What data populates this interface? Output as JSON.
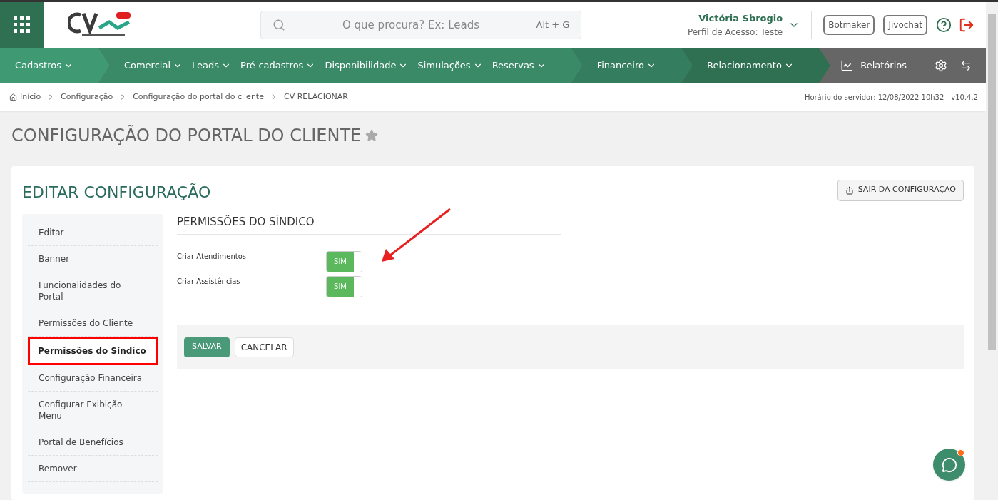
{
  "header": {
    "search": {
      "placeholder": "O que procura? Ex: Leads",
      "shortcut": "Alt + G"
    },
    "user": {
      "name": "Victória Sbrogio",
      "profile": "Perfil de Acesso: Teste"
    },
    "buttons": [
      "Botmaker",
      "Jivochat"
    ]
  },
  "nav": {
    "segments": [
      {
        "color": "#3f9a74",
        "items": [
          "Cadastros"
        ]
      },
      {
        "color": "#3a8a68",
        "items": [
          "Comercial",
          "Leads",
          "Pré-cadastros",
          "Disponibilidade",
          "Simulações",
          "Reservas"
        ]
      },
      {
        "color": "#357d5f",
        "items": [
          "Financeiro"
        ]
      },
      {
        "color": "#2f7053",
        "items": [
          "Relacionamento"
        ]
      }
    ],
    "reports": "Relatórios"
  },
  "breadcrumb": [
    "Início",
    "Configuração",
    "Configuração do portal do cliente",
    "CV RELACIONAR"
  ],
  "server_time": "Horário do servidor: 12/08/2022 10h32 - v10.4.2",
  "page_title": "CONFIGURAÇÃO DO PORTAL DO CLIENTE",
  "card": {
    "title": "EDITAR CONFIGURAÇÃO",
    "exit_button": "SAIR DA CONFIGURAÇÃO",
    "sidebar": [
      {
        "label": "Editar",
        "selected": false
      },
      {
        "label": "Banner",
        "selected": false
      },
      {
        "label": "Funcionalidades do Portal",
        "selected": false
      },
      {
        "label": "Permissões do Cliente",
        "selected": false
      },
      {
        "label": "Permissões do Síndico",
        "selected": true
      },
      {
        "label": "Configuração Financeira",
        "selected": false
      },
      {
        "label": "Configurar Exibição Menu",
        "selected": false
      },
      {
        "label": "Portal de Benefícios",
        "selected": false
      },
      {
        "label": "Remover",
        "selected": false
      }
    ],
    "section_title": "PERMISSÕES DO SÍNDICO",
    "toggles": [
      {
        "label": "Criar Atendimentos",
        "on": true,
        "text": "SIM"
      },
      {
        "label": "Criar Assistências",
        "on": true,
        "text": "SIM"
      }
    ],
    "save": "SALVAR",
    "cancel": "CANCELAR"
  }
}
